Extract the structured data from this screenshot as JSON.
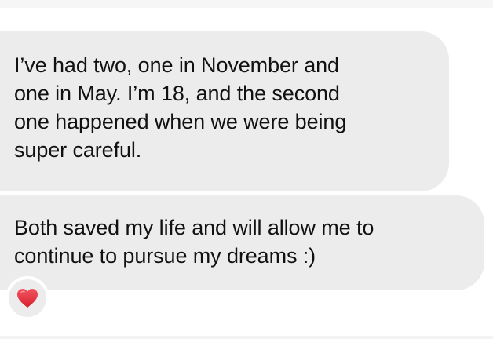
{
  "messages": [
    {
      "text": "I’ve had two, one in November and\none in May. I’m 18, and the second\none happened when we were being\nsuper careful."
    },
    {
      "text": "Both saved my life and will allow me to\ncontinue to pursue my dreams :)"
    }
  ],
  "reaction": {
    "icon": "red-heart-icon",
    "color": "#e0303a"
  },
  "colors": {
    "bubble": "#ececec",
    "text": "#111111",
    "background": "#ffffff"
  }
}
